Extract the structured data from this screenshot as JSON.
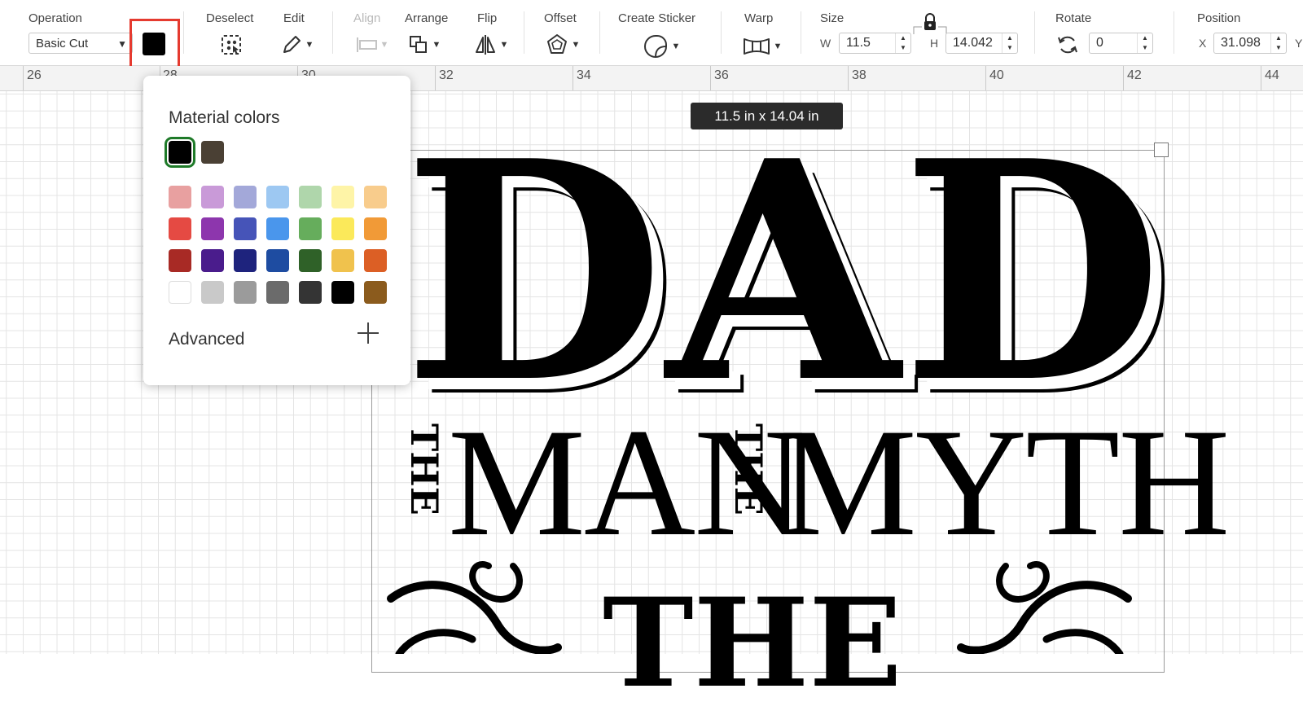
{
  "toolbar": {
    "operation": {
      "label": "Operation",
      "value": "Basic Cut"
    },
    "deselect": {
      "label": "Deselect"
    },
    "edit": {
      "label": "Edit"
    },
    "align": {
      "label": "Align"
    },
    "arrange": {
      "label": "Arrange"
    },
    "flip": {
      "label": "Flip"
    },
    "offset": {
      "label": "Offset"
    },
    "create_sticker": {
      "label": "Create Sticker"
    },
    "warp": {
      "label": "Warp"
    },
    "size": {
      "label": "Size",
      "w_label": "W",
      "w_value": "11.5",
      "h_label": "H",
      "h_value": "14.042"
    },
    "rotate": {
      "label": "Rotate",
      "value": "0"
    },
    "position": {
      "label": "Position",
      "x_label": "X",
      "x_value": "31.098",
      "y_label": "Y"
    },
    "material_color": "#000000"
  },
  "ruler": {
    "ticks": [
      "26",
      "28",
      "30",
      "32",
      "34",
      "36",
      "38",
      "40",
      "42",
      "44"
    ]
  },
  "canvas": {
    "dimension_tooltip": "11.5  in x 14.04  in",
    "artwork": {
      "line1": "DAD",
      "line2_a": "MAN",
      "line2_b": "MYTH",
      "small_the": "THE",
      "line3": "THE"
    }
  },
  "popup": {
    "title": "Material colors",
    "material_swatches": [
      "#000000",
      "#4a4034"
    ],
    "palette": [
      [
        "#e8a0a0",
        "#c99ad8",
        "#a3a8d9",
        "#9dc8f2",
        "#afd6ab",
        "#fef4a7",
        "#f8cc8c"
      ],
      [
        "#e54a43",
        "#8d36ad",
        "#4654b8",
        "#4a96ec",
        "#66ad5c",
        "#fbe95a",
        "#f19a37"
      ],
      [
        "#a82a25",
        "#4a1c8c",
        "#1e237d",
        "#1e4ca1",
        "#2f6128",
        "#f0c24d",
        "#dc5f25"
      ],
      [
        "#ffffff",
        "#c9c9c9",
        "#9b9b9b",
        "#6b6b6b",
        "#343434",
        "#000000",
        "#8b5b1d"
      ]
    ],
    "advanced_label": "Advanced"
  }
}
